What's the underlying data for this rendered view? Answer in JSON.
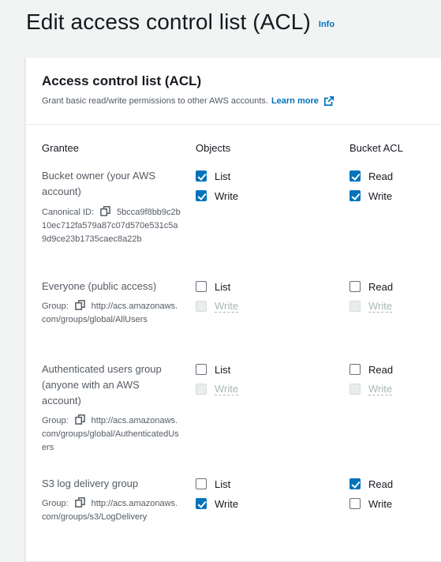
{
  "page": {
    "title": "Edit access control list (ACL)",
    "info": "Info"
  },
  "panel": {
    "title": "Access control list (ACL)",
    "description": "Grant basic read/write permissions to other AWS accounts.",
    "learn_more": "Learn more"
  },
  "columns": {
    "grantee": "Grantee",
    "objects": "Objects",
    "bucket_acl": "Bucket ACL"
  },
  "rows": [
    {
      "name": "Bucket owner (your AWS account)",
      "meta_label": "Canonical ID:",
      "meta_value": "5bcca9f8bb9c2b10ec712fa579a87c07d570e531c5a9d9ce23b1735caec8a22b",
      "objects": {
        "list": {
          "label": "List",
          "checked": true,
          "disabled": false
        },
        "write": {
          "label": "Write",
          "checked": true,
          "disabled": false
        }
      },
      "bucket": {
        "read": {
          "label": "Read",
          "checked": true,
          "disabled": false
        },
        "write": {
          "label": "Write",
          "checked": true,
          "disabled": false
        }
      }
    },
    {
      "name": "Everyone (public access)",
      "meta_label": "Group:",
      "meta_value": "http://acs.amazonaws.com/groups/global/AllUsers",
      "objects": {
        "list": {
          "label": "List",
          "checked": false,
          "disabled": false
        },
        "write": {
          "label": "Write",
          "checked": false,
          "disabled": true
        }
      },
      "bucket": {
        "read": {
          "label": "Read",
          "checked": false,
          "disabled": false
        },
        "write": {
          "label": "Write",
          "checked": false,
          "disabled": true
        }
      }
    },
    {
      "name": "Authenticated users group (anyone with an AWS account)",
      "meta_label": "Group:",
      "meta_value": "http://acs.amazonaws.com/groups/global/AuthenticatedUsers",
      "objects": {
        "list": {
          "label": "List",
          "checked": false,
          "disabled": false
        },
        "write": {
          "label": "Write",
          "checked": false,
          "disabled": true
        }
      },
      "bucket": {
        "read": {
          "label": "Read",
          "checked": false,
          "disabled": false
        },
        "write": {
          "label": "Write",
          "checked": false,
          "disabled": true
        }
      }
    },
    {
      "name": "S3 log delivery group",
      "meta_label": "Group:",
      "meta_value": "http://acs.amazonaws.com/groups/s3/LogDelivery",
      "objects": {
        "list": {
          "label": "List",
          "checked": false,
          "disabled": false
        },
        "write": {
          "label": "Write",
          "checked": true,
          "disabled": false
        }
      },
      "bucket": {
        "read": {
          "label": "Read",
          "checked": true,
          "disabled": false
        },
        "write": {
          "label": "Write",
          "checked": false,
          "disabled": false
        }
      }
    }
  ],
  "colors": {
    "accent": "#0073bb",
    "text": "#16191f",
    "muted": "#545b64",
    "background": "#f2f3f3"
  },
  "icons": {
    "external": "external-link-icon",
    "copy": "copy-icon"
  }
}
